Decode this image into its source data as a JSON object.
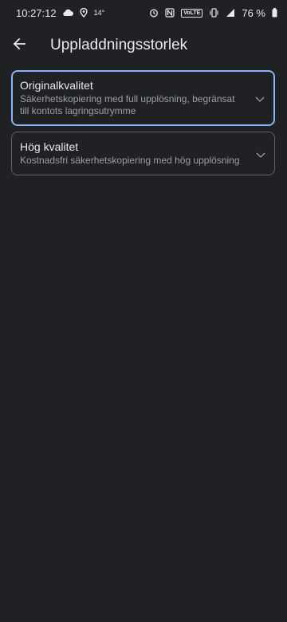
{
  "status_bar": {
    "time": "10:27:12",
    "temperature": "14°",
    "network_badge": "VoLTE",
    "battery": "76 %"
  },
  "app_bar": {
    "title": "Uppladdningsstorlek"
  },
  "options": [
    {
      "title": "Originalkvalitet",
      "description": "Säkerhetskopiering med full upplösning, begränsat till kontots lagringsutrymme",
      "selected": true
    },
    {
      "title": "Hög kvalitet",
      "description": "Kostnadsfri säkerhetskopiering med hög upplösning",
      "selected": false
    }
  ],
  "colors": {
    "background": "#202124",
    "text_primary": "#e8eaed",
    "text_secondary": "#9aa0a6",
    "selected_border": "#8ab4f8",
    "border": "#5f6368"
  }
}
